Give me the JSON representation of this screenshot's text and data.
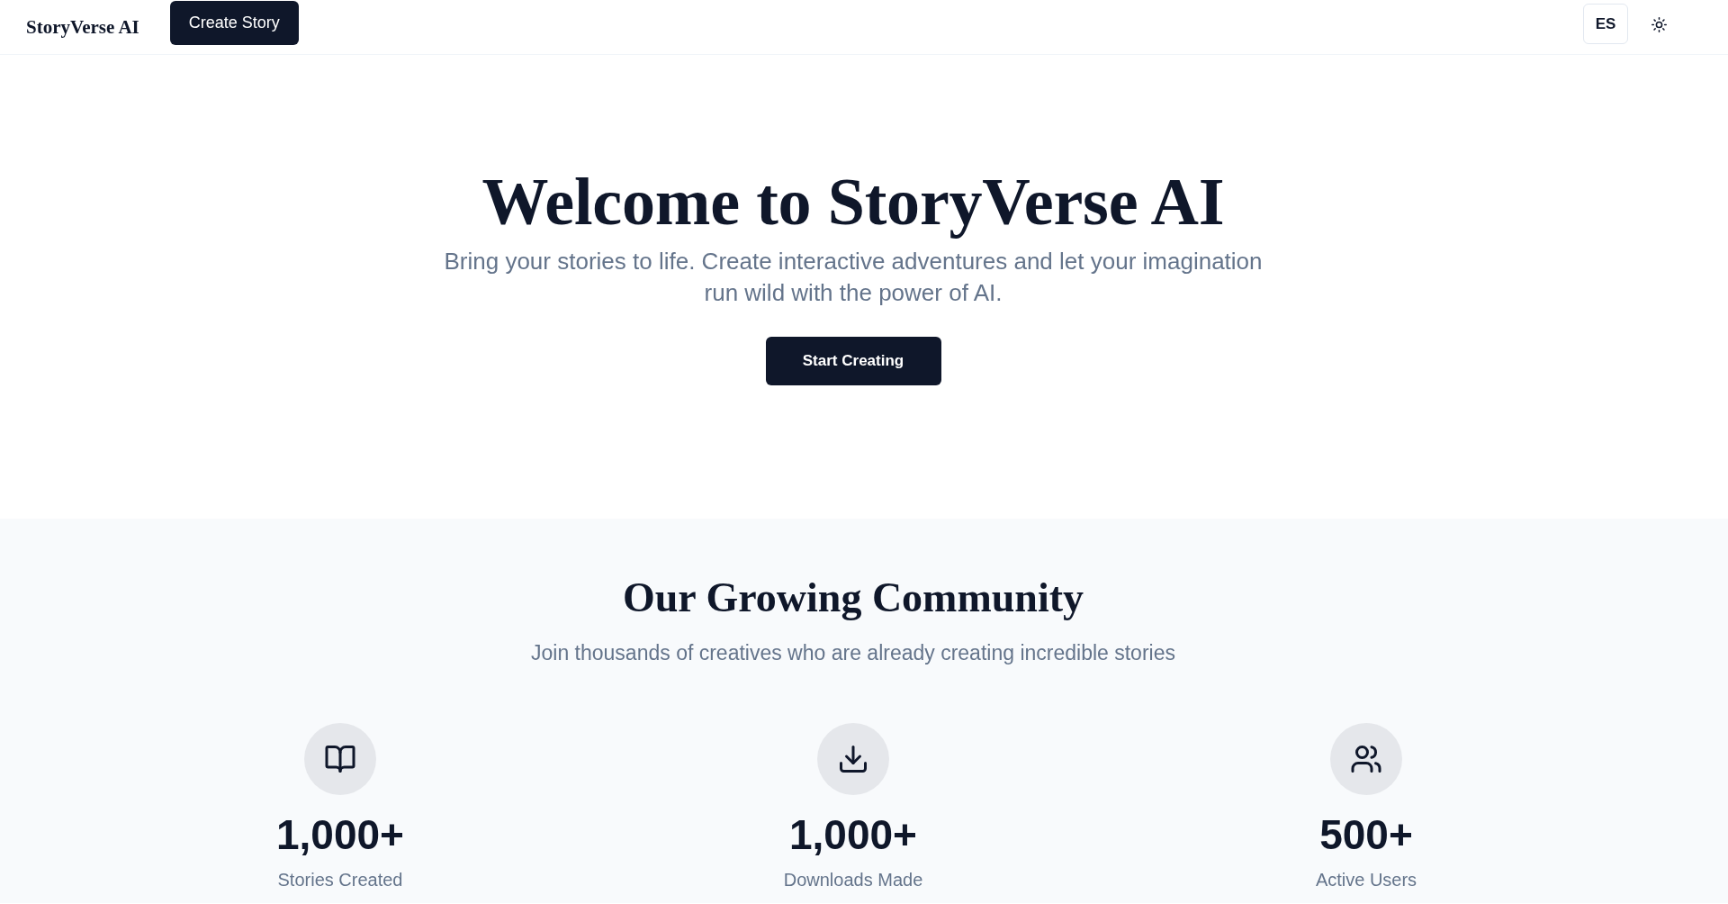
{
  "header": {
    "logo": "StoryVerse AI",
    "create_button": "Create Story",
    "language_button": "ES"
  },
  "hero": {
    "title": "Welcome to StoryVerse AI",
    "subtitle": "Bring your stories to life. Create interactive adventures and let your imagination run wild with the power of AI.",
    "cta_button": "Start Creating"
  },
  "community": {
    "title": "Our Growing Community",
    "subtitle": "Join thousands of creatives who are already creating incredible stories",
    "stats": [
      {
        "kind": "book",
        "value": "1,000+",
        "label": "Stories Created"
      },
      {
        "kind": "download",
        "value": "1,000+",
        "label": "Downloads Made"
      },
      {
        "kind": "users",
        "value": "500+",
        "label": "Active Users"
      }
    ]
  }
}
